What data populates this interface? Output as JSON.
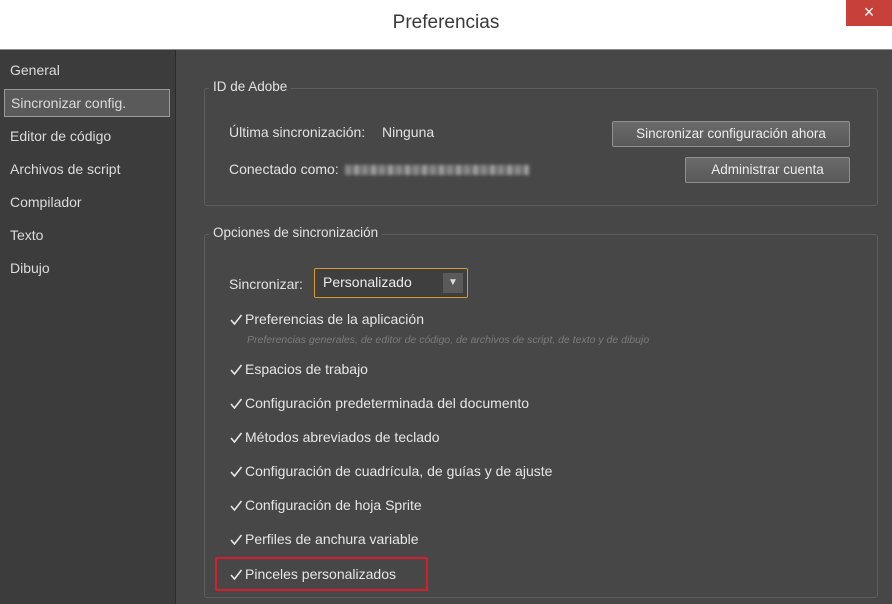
{
  "window": {
    "title": "Preferencias",
    "close_glyph": "×"
  },
  "sidebar": {
    "items": [
      {
        "label": "General"
      },
      {
        "label": "Sincronizar config."
      },
      {
        "label": "Editor de código"
      },
      {
        "label": "Archivos de script"
      },
      {
        "label": "Compilador"
      },
      {
        "label": "Texto"
      },
      {
        "label": "Dibujo"
      }
    ],
    "selected": "Sincronizar config."
  },
  "adobe_id": {
    "legend": "ID de Adobe",
    "last_sync_label": "Última sincronización:",
    "last_sync_value": "Ninguna",
    "connected_label": "Conectado como:",
    "sync_now_button": "Sincronizar configuración ahora",
    "manage_account_button": "Administrar cuenta"
  },
  "sync_options": {
    "legend": "Opciones de sincronización",
    "sync_label": "Sincronizar:",
    "sync_value": "Personalizado",
    "app_prefs_description": "Preferencias generales, de editor de código, de archivos de script, de texto y de dibujo",
    "options": [
      {
        "label": "Preferencias de la aplicación",
        "checked": true
      },
      {
        "label": "Espacios de trabajo",
        "checked": true
      },
      {
        "label": "Configuración predeterminada del documento",
        "checked": true
      },
      {
        "label": "Métodos abreviados de teclado",
        "checked": true
      },
      {
        "label": "Configuración de cuadrícula, de guías y de ajuste",
        "checked": true
      },
      {
        "label": "Configuración de hoja Sprite",
        "checked": true
      },
      {
        "label": "Perfiles de anchura variable",
        "checked": true
      },
      {
        "label": "Pinceles personalizados",
        "checked": true
      }
    ]
  },
  "colors": {
    "background": "#474747",
    "highlight": "#d32028",
    "dropdown_border": "#d69a2d",
    "close_button": "#c7403a"
  }
}
